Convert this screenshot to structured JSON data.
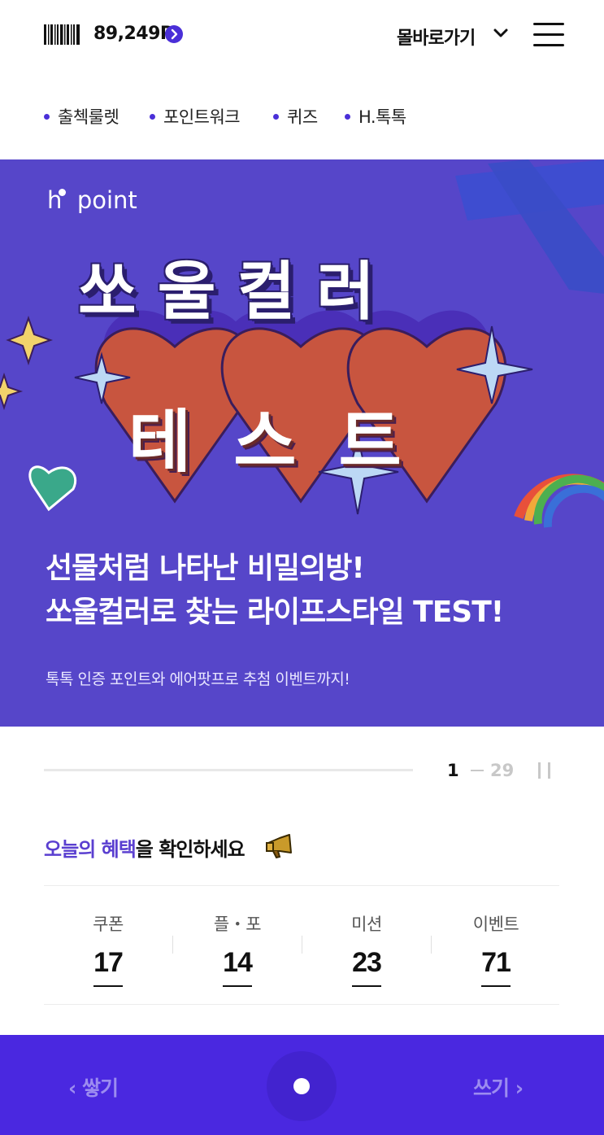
{
  "header": {
    "points": "89,249P",
    "mall_link": "몰바로가기"
  },
  "quick_links": [
    "출첵룰렛",
    "포인트워크",
    "퀴즈",
    "H.톡톡"
  ],
  "banner": {
    "logo": "point",
    "title_line1": "쏘울컬러",
    "title_line2": "테스트",
    "headline_line1": "선물처럼 나타난 비밀의방!",
    "headline_line2": "쏘울컬러로 찾는 라이프스타일 TEST!",
    "subline": "톡톡 인증 포인트와 에어팟프로 추첨 이벤트까지!",
    "background_color": "#5646c9"
  },
  "pager": {
    "current": "1",
    "total": "29"
  },
  "benefits": {
    "title_highlight_1": "오늘의",
    "title_highlight_2": "혜택",
    "title_rest": "을 확인하세요",
    "items": [
      {
        "label": "쿠폰",
        "value": "17"
      },
      {
        "label": "플・포",
        "value": "14"
      },
      {
        "label": "미션",
        "value": "23"
      },
      {
        "label": "이벤트",
        "value": "71"
      }
    ]
  },
  "bottom_bar": {
    "left_label": "쌓기",
    "right_label": "쓰기",
    "color": "#4a28e0"
  }
}
